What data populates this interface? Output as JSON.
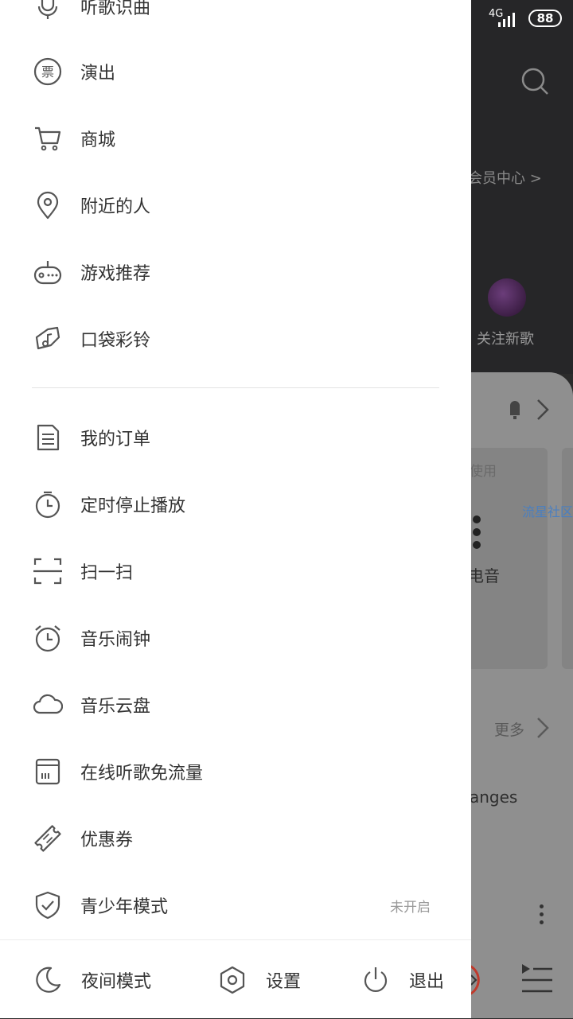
{
  "status_bar": {
    "network": "4G",
    "battery": "88"
  },
  "background": {
    "vip_center": "会员中心",
    "follow_new_songs": "关注新歌",
    "card_hint": "使用",
    "community_link": "流星社区",
    "card_title": "电音",
    "more": "更多",
    "song_fragment": "anges"
  },
  "drawer": {
    "partial_item": {
      "label": "听歌识曲",
      "icon": "microphone-icon"
    },
    "group1": [
      {
        "label": "演出",
        "icon": "ticket-icon"
      },
      {
        "label": "商城",
        "icon": "cart-icon"
      },
      {
        "label": "附近的人",
        "icon": "location-pin-icon"
      },
      {
        "label": "游戏推荐",
        "icon": "game-controller-icon"
      },
      {
        "label": "口袋彩铃",
        "icon": "music-note-icon"
      }
    ],
    "group2": [
      {
        "label": "我的订单",
        "icon": "document-icon"
      },
      {
        "label": "定时停止播放",
        "icon": "timer-icon"
      },
      {
        "label": "扫一扫",
        "icon": "scan-icon"
      },
      {
        "label": "音乐闹钟",
        "icon": "alarm-clock-icon"
      },
      {
        "label": "音乐云盘",
        "icon": "cloud-icon"
      },
      {
        "label": "在线听歌免流量",
        "icon": "sim-card-icon"
      },
      {
        "label": "优惠券",
        "icon": "coupon-icon"
      },
      {
        "label": "青少年模式",
        "icon": "shield-check-icon",
        "status": "未开启"
      }
    ]
  },
  "bottom_bar": {
    "night_mode": "夜间模式",
    "settings": "设置",
    "logout": "退出"
  }
}
